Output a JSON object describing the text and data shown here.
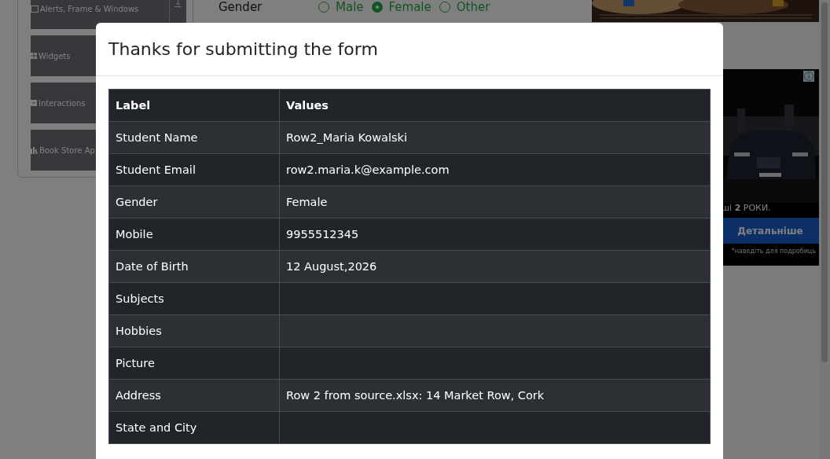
{
  "sidebar": {
    "items": [
      {
        "label": "Alerts, Frame & Windows"
      },
      {
        "label": "Widgets"
      },
      {
        "label": "Interactions"
      },
      {
        "label": "Book Store Ap"
      }
    ]
  },
  "form": {
    "label": "Gender",
    "options": [
      {
        "label": "Male",
        "selected": false
      },
      {
        "label": "Female",
        "selected": true
      },
      {
        "label": "Other",
        "selected": false
      }
    ]
  },
  "ad": {
    "caption": "ші **2** РОКИ.",
    "button": "Детальніше",
    "note": "*наведіть для подробиць"
  },
  "modal": {
    "title": "Thanks for submitting the form",
    "table": {
      "columns": [
        "Label",
        "Values"
      ],
      "rows": [
        {
          "label": "Student Name",
          "value": "Row2_Maria Kowalski"
        },
        {
          "label": "Student Email",
          "value": "row2.maria.k@example.com"
        },
        {
          "label": "Gender",
          "value": "Female"
        },
        {
          "label": "Mobile",
          "value": "9955512345"
        },
        {
          "label": "Date of Birth",
          "value": "12 August,2026"
        },
        {
          "label": "Subjects"
        },
        {
          "label": "Hobbies"
        },
        {
          "label": "Picture"
        },
        {
          "label": "Address",
          "value": "Row 2 from source.xlsx: 14 Market Row, Cork"
        },
        {
          "label": "State and City"
        }
      ]
    }
  }
}
